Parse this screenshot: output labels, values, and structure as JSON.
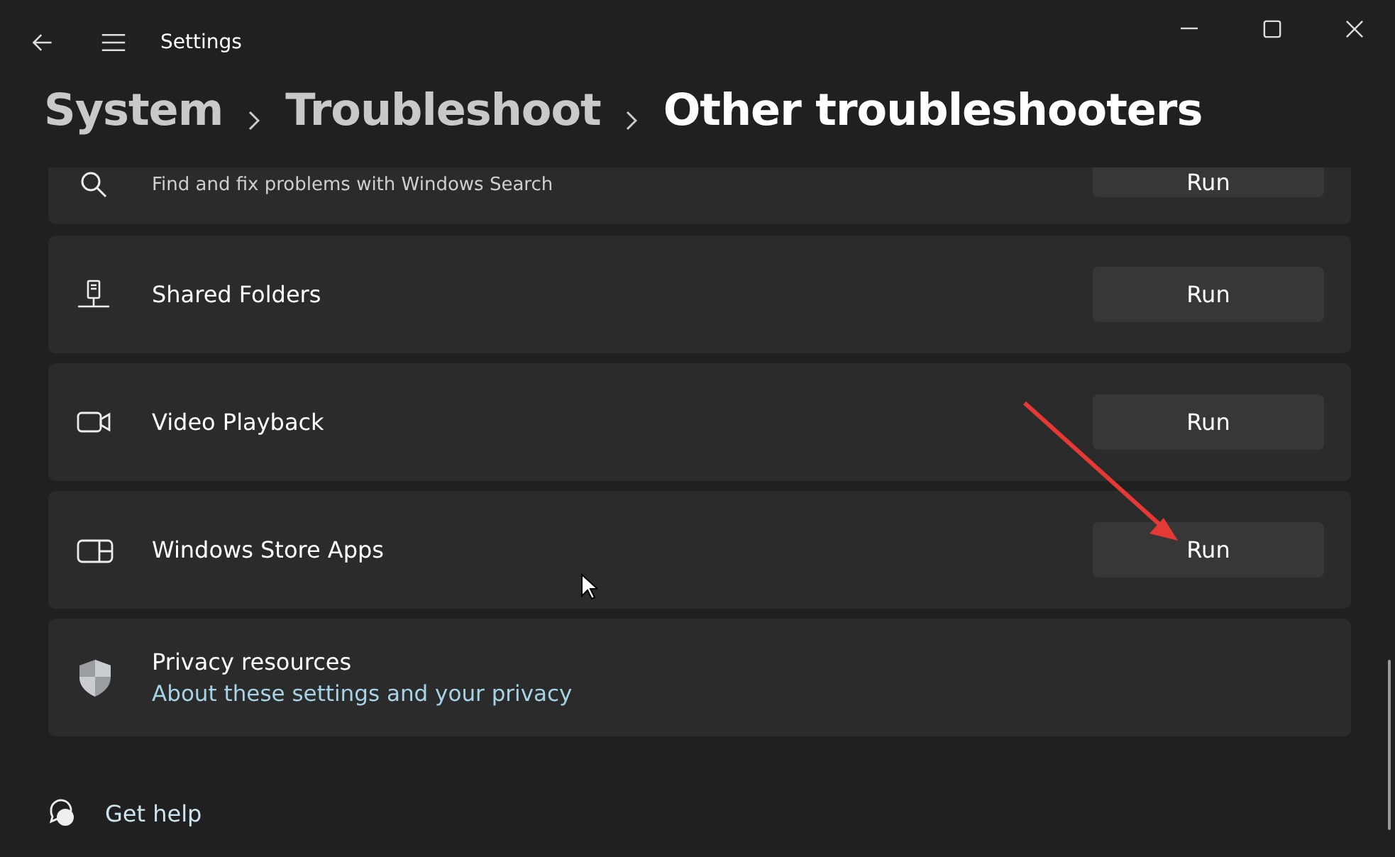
{
  "window": {
    "title": "Settings"
  },
  "breadcrumb": [
    {
      "label": "System",
      "current": false
    },
    {
      "label": "Troubleshoot",
      "current": false
    },
    {
      "label": "Other troubleshooters",
      "current": true
    }
  ],
  "troubleshooters": [
    {
      "kind": "partial",
      "description": "Find and fix problems with Windows Search",
      "button": "Run"
    },
    {
      "kind": "item",
      "title": "Shared Folders",
      "button": "Run"
    },
    {
      "kind": "item",
      "title": "Video Playback",
      "button": "Run"
    },
    {
      "kind": "item",
      "title": "Windows Store Apps",
      "button": "Run"
    },
    {
      "kind": "link",
      "title": "Privacy resources",
      "link": "About these settings and your privacy"
    }
  ],
  "help": {
    "label": "Get help"
  }
}
